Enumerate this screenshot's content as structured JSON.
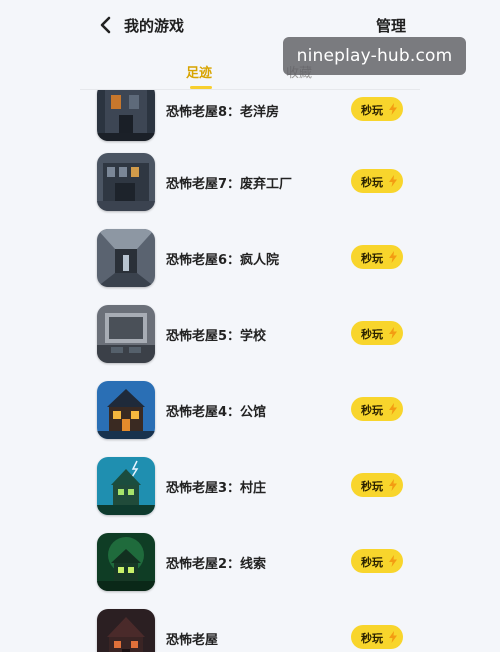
{
  "header": {
    "title": "我的游戏",
    "manage_label": "管理"
  },
  "tabs": [
    {
      "label": "足迹",
      "active": true
    },
    {
      "label": "收藏",
      "active": false
    }
  ],
  "watermark": "nineplay-hub.com",
  "games": [
    {
      "name": "恐怖老屋8：老洋房",
      "play_label": "秒玩",
      "icon": "old-mansion-game-icon"
    },
    {
      "name": "恐怖老屋7：废弃工厂",
      "play_label": "秒玩",
      "icon": "abandoned-factory-game-icon"
    },
    {
      "name": "恐怖老屋6：疯人院",
      "play_label": "秒玩",
      "icon": "asylum-game-icon"
    },
    {
      "name": "恐怖老屋5：学校",
      "play_label": "秒玩",
      "icon": "school-game-icon"
    },
    {
      "name": "恐怖老屋4：公馆",
      "play_label": "秒玩",
      "icon": "manor-game-icon"
    },
    {
      "name": "恐怖老屋3：村庄",
      "play_label": "秒玩",
      "icon": "village-game-icon"
    },
    {
      "name": "恐怖老屋2：线索",
      "play_label": "秒玩",
      "icon": "clue-game-icon"
    },
    {
      "name": "恐怖老屋",
      "play_label": "秒玩",
      "icon": "haunted-house-game-icon"
    }
  ],
  "colors": {
    "accent": "#f7cf2f",
    "active_tab_text": "#d8a400",
    "background": "#f4f6fa"
  }
}
